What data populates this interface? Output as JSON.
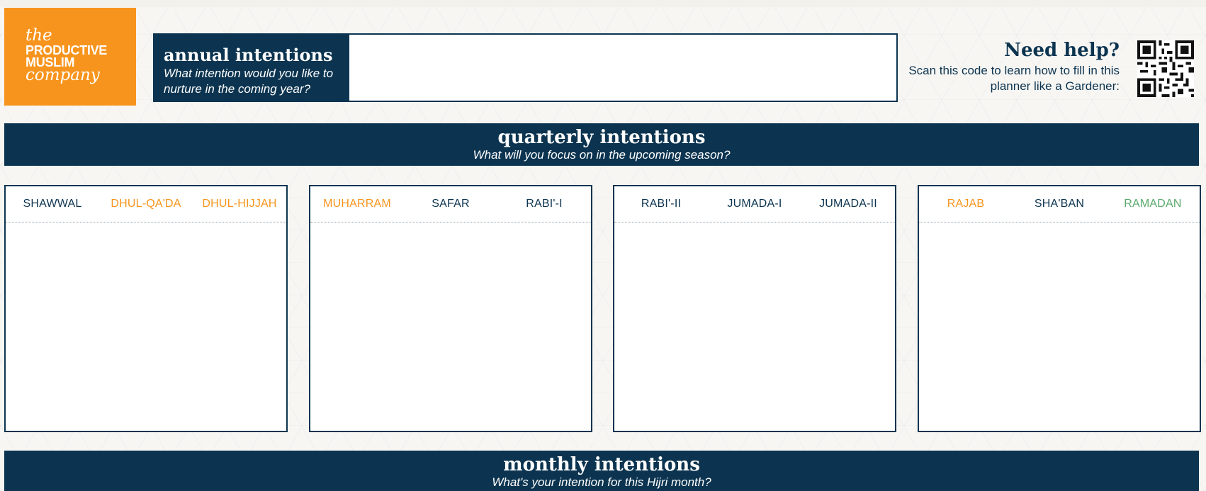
{
  "logo": {
    "line1": "the",
    "line2": "PRODUCTIVE",
    "line3": "MUSLIM",
    "line4": "company"
  },
  "annual": {
    "title": "annual intentions",
    "prompt": "What intention would you like to nurture in the coming year?"
  },
  "help": {
    "title": "Need help?",
    "text": "Scan this code to learn how to fill in this planner like a Gardener:"
  },
  "quarterly": {
    "title": "quarterly intentions",
    "subtitle": "What will you focus on in the upcoming season?"
  },
  "quarters": [
    {
      "months": [
        {
          "name": "SHAWWAL",
          "color": "#0c3450"
        },
        {
          "name": "DHUL-QA'DA",
          "color": "#f7941d"
        },
        {
          "name": "DHUL-HIJJAH",
          "color": "#f7941d"
        }
      ]
    },
    {
      "months": [
        {
          "name": "MUHARRAM",
          "color": "#f7941d"
        },
        {
          "name": "SAFAR",
          "color": "#0c3450"
        },
        {
          "name": "RABI'-I",
          "color": "#0c3450"
        }
      ]
    },
    {
      "months": [
        {
          "name": "RABI'-II",
          "color": "#0c3450"
        },
        {
          "name": "JUMADA-I",
          "color": "#0c3450"
        },
        {
          "name": "JUMADA-II",
          "color": "#0c3450"
        }
      ]
    },
    {
      "months": [
        {
          "name": "RAJAB",
          "color": "#f7941d"
        },
        {
          "name": "SHA'BAN",
          "color": "#0c3450"
        },
        {
          "name": "RAMADAN",
          "color": "#5aa96b"
        }
      ]
    }
  ],
  "monthly": {
    "title": "monthly intentions",
    "subtitle": "What's your intention for this Hijri month?"
  },
  "colors": {
    "navy": "#0c3450",
    "orange": "#f7941d",
    "green": "#5aa96b"
  },
  "icons": {
    "qr": "qr-code-icon"
  }
}
